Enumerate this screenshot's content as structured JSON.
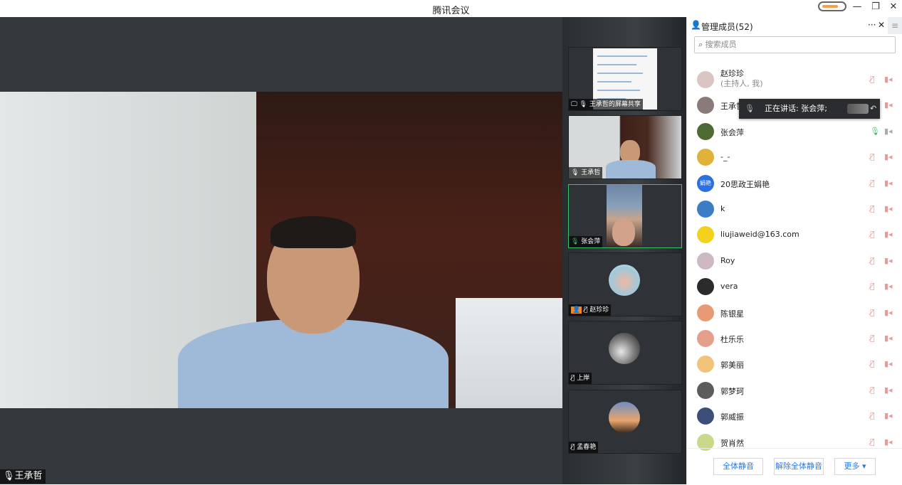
{
  "app": {
    "title": "腾讯会议"
  },
  "window": {
    "minimize": "—",
    "restore": "❐",
    "close": "✕"
  },
  "main_video": {
    "speaker_label": "王承哲"
  },
  "thumbnails": [
    {
      "label": "王承哲的屏幕共享",
      "kind": "screen-share"
    },
    {
      "label": "王承哲",
      "kind": "video"
    },
    {
      "label": "张会萍",
      "kind": "video",
      "active": true
    },
    {
      "label": "赵珍珍",
      "kind": "avatar"
    },
    {
      "label": "上岸",
      "kind": "avatar"
    },
    {
      "label": "孟春艳",
      "kind": "avatar"
    }
  ],
  "panel": {
    "title": "管理成员(52)",
    "more": "···",
    "close": "✕",
    "menu": "≡",
    "search_placeholder": "搜索成员",
    "speaking_text": "正在讲话: 张会萍;",
    "members": [
      {
        "name": "赵珍珍",
        "sub": "(主持人, 我)",
        "color": "#d9c6c0"
      },
      {
        "name": "王承哲",
        "sub": "",
        "color": "#8a7b7a"
      },
      {
        "name": "张会萍",
        "sub": "",
        "color": "#4e6b33",
        "mic": "on"
      },
      {
        "name": "-_-",
        "sub": "",
        "color": "#e0b23a"
      },
      {
        "name": "20思政王娟艳",
        "sub": "",
        "color": "#2c6fe0",
        "avatar_text": "娟艳"
      },
      {
        "name": "k",
        "sub": "",
        "color": "#3b7cc4"
      },
      {
        "name": "liujiaweid@163.com",
        "sub": "",
        "color": "#f2d21d"
      },
      {
        "name": "Roy",
        "sub": "",
        "color": "#cbb9c4"
      },
      {
        "name": "vera",
        "sub": "",
        "color": "#2b2b2b"
      },
      {
        "name": "陈银星",
        "sub": "",
        "color": "#e79a74"
      },
      {
        "name": "杜乐乐",
        "sub": "",
        "color": "#e4a08a"
      },
      {
        "name": "郭美丽",
        "sub": "",
        "color": "#f0c27a"
      },
      {
        "name": "郭梦珂",
        "sub": "",
        "color": "#5c5c5c"
      },
      {
        "name": "郭威振",
        "sub": "",
        "color": "#3b4f7a"
      },
      {
        "name": "贺肖然",
        "sub": "",
        "color": "#c9d98a"
      }
    ],
    "footer": {
      "mute_all": "全体静音",
      "unmute_all": "解除全体静音",
      "more": "更多 ▾"
    }
  }
}
